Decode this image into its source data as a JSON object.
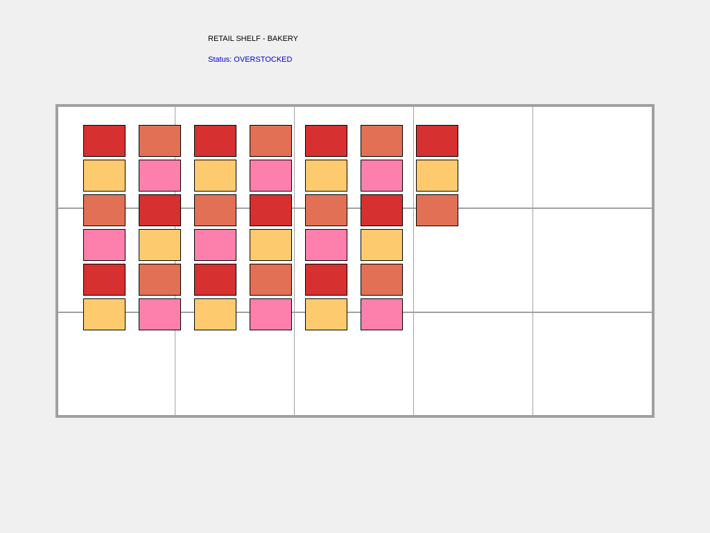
{
  "header": {
    "title": "RETAIL SHELF - BAKERY",
    "status": "Status: OVERSTOCKED"
  },
  "colors": {
    "red": "#d63031",
    "salmon": "#e17055",
    "yellow": "#fdcb6e",
    "pink": "#fd7fab"
  },
  "shelf": {
    "columns": 5,
    "rows": 3,
    "products": [
      [
        "red",
        "salmon",
        "red",
        "salmon",
        "red",
        "salmon",
        "red"
      ],
      [
        "yellow",
        "pink",
        "yellow",
        "pink",
        "yellow",
        "pink",
        "yellow"
      ],
      [
        "salmon",
        "red",
        "salmon",
        "red",
        "salmon",
        "red",
        "salmon"
      ],
      [
        "pink",
        "yellow",
        "pink",
        "yellow",
        "pink",
        "yellow"
      ],
      [
        "red",
        "salmon",
        "red",
        "salmon",
        "red",
        "salmon"
      ],
      [
        "yellow",
        "pink",
        "yellow",
        "pink",
        "yellow",
        "pink"
      ]
    ]
  }
}
